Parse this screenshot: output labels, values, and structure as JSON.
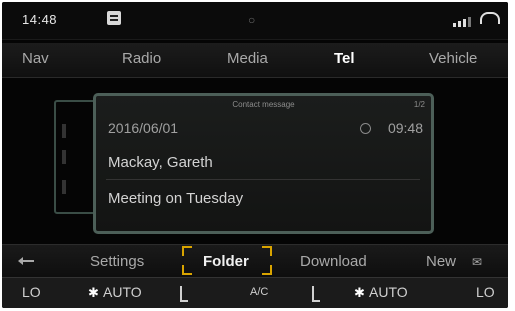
{
  "status": {
    "time": "14:48",
    "message_icon": "message-icon",
    "center_icon": "connection-icon",
    "signal_icon": "signal-bars-icon",
    "phone_icon": "phone-icon"
  },
  "nav": {
    "tabs": [
      {
        "label": "Nav"
      },
      {
        "label": "Radio"
      },
      {
        "label": "Media"
      },
      {
        "label": "Tel"
      },
      {
        "label": "Vehicle"
      }
    ],
    "active_index": 3
  },
  "message": {
    "heading": "Contact message",
    "index": "1/2",
    "date": "2016/06/01",
    "time": "09:48",
    "sender": "Mackay, Gareth",
    "subject": "Meeting on Tuesday"
  },
  "softkeys": {
    "items": [
      {
        "label": "Settings"
      },
      {
        "label": "Folder"
      },
      {
        "label": "Download"
      },
      {
        "label": "New"
      }
    ],
    "selected_index": 1,
    "accent_color": "#d9a400"
  },
  "climate": {
    "left_temp": "LO",
    "left_fan": "AUTO",
    "ac_label": "A/C",
    "right_fan": "AUTO",
    "right_temp": "LO"
  }
}
